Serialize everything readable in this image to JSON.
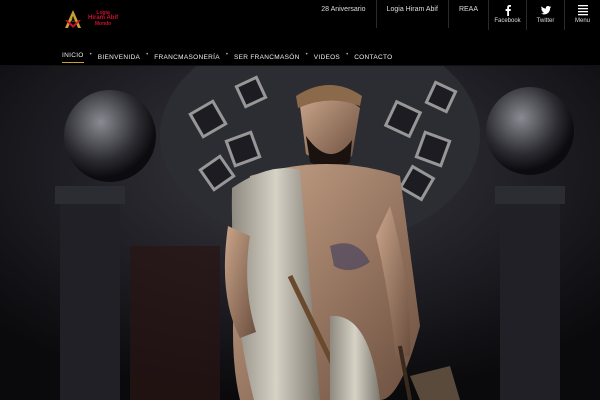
{
  "site": {
    "logo": {
      "line1": "Logia",
      "line2": "Hiram Abif",
      "line3": "Mondo"
    }
  },
  "toplinks": [
    "28 Aniversario",
    "Logia Hiram Abif",
    "REAA"
  ],
  "social": {
    "facebook_label": "Facebook",
    "twitter_label": "Twitter",
    "menu_label": "Menu"
  },
  "nav": {
    "items": [
      "Inicio",
      "Bienvenida",
      "Francmasonería",
      "Ser Francmasón",
      "Videos",
      "Contacto"
    ]
  },
  "colors": {
    "brand_red": "#c8102e",
    "accent_gold": "#c8a036"
  },
  "hero": {
    "icon": "hiram-abif-painting"
  }
}
